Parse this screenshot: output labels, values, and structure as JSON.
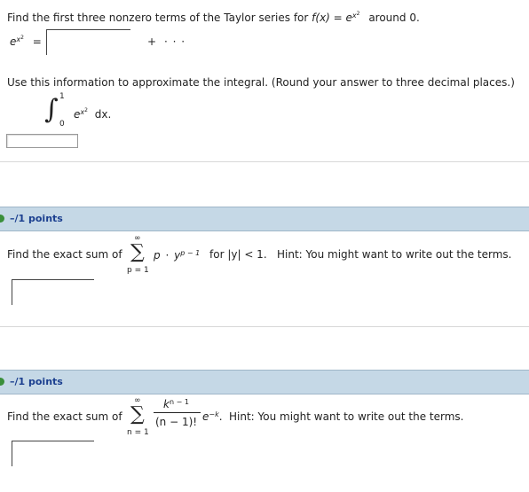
{
  "q1": {
    "prompt_prefix": "Find the first three nonzero terms of the Taylor series for",
    "func_lhs": "f(x) = e",
    "func_exp": "x",
    "func_exp_sup": "2",
    "around": "around 0.",
    "series_base": "e",
    "series_exp": "x",
    "series_exp_sup": "2",
    "equals": "=",
    "plus": "+",
    "dots": "· · ·",
    "approx_prompt": "Use this information to approximate the integral. (Round your answer to three decimal places.)",
    "integral_upper": "1",
    "integral_lower": "0",
    "integrand_base": "e",
    "integrand_exp": "x",
    "integrand_exp_sup": "2",
    "dx": "dx."
  },
  "q2": {
    "points": "–/1 points",
    "prompt": "Find the exact sum of",
    "sum_upper": "∞",
    "sum_lower": "p = 1",
    "term_p": "p",
    "term_dot": "·",
    "term_y": "y",
    "term_exp": "p − 1",
    "condition": "for |y| < 1.",
    "hint": "Hint: You might want to write out the terms."
  },
  "q3": {
    "points": "–/1 points",
    "prompt": "Find the exact sum of",
    "sum_upper": "∞",
    "sum_lower": "n = 1",
    "numerator": "k",
    "numerator_exp": "n − 1",
    "denominator": "(n − 1)!",
    "factor": "e",
    "factor_exp": "−k",
    "period": ".",
    "hint": "Hint: You might want to write out the terms."
  }
}
